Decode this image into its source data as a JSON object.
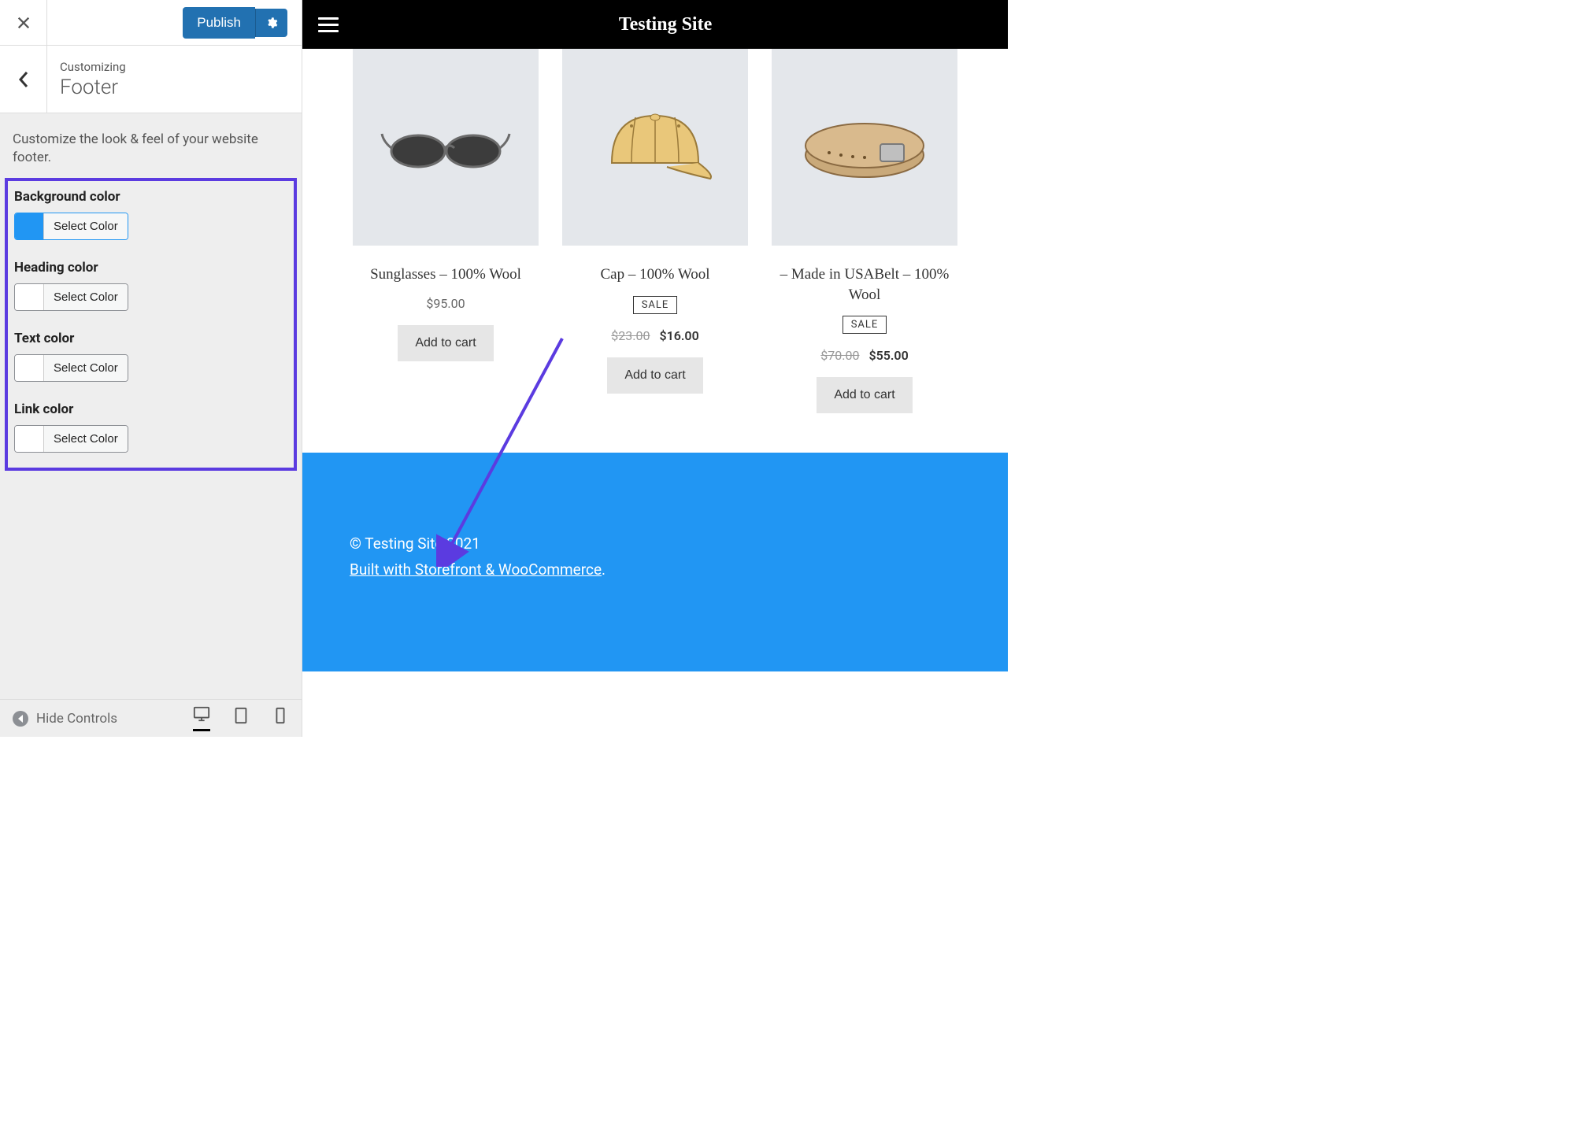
{
  "sidebar": {
    "publish_label": "Publish",
    "eyebrow": "Customizing",
    "title": "Footer",
    "description": "Customize the look & feel of your website footer.",
    "controls": [
      {
        "label": "Background color",
        "swatch": "#2196f3",
        "button": "Select Color",
        "active": true
      },
      {
        "label": "Heading color",
        "swatch": "#ffffff",
        "button": "Select Color",
        "active": false
      },
      {
        "label": "Text color",
        "swatch": "#ffffff",
        "button": "Select Color",
        "active": false
      },
      {
        "label": "Link color",
        "swatch": "#ffffff",
        "button": "Select Color",
        "active": false
      }
    ],
    "hide_controls_label": "Hide Controls"
  },
  "preview": {
    "site_title": "Testing Site",
    "products": [
      {
        "title": "Sunglasses – 100% Wool",
        "price": "$95.00",
        "sale": false,
        "button": "Add to cart"
      },
      {
        "title": "Cap – 100% Wool",
        "old_price": "$23.00",
        "price": "$16.00",
        "sale": true,
        "sale_label": "SALE",
        "button": "Add to cart"
      },
      {
        "title": "– Made in USABelt – 100% Wool",
        "old_price": "$70.00",
        "price": "$55.00",
        "sale": true,
        "sale_label": "SALE",
        "button": "Add to cart"
      }
    ],
    "footer": {
      "copyright": "© Testing Site 2021",
      "link_text": "Built with Storefront & WooCommerce",
      "link_suffix": "."
    }
  }
}
